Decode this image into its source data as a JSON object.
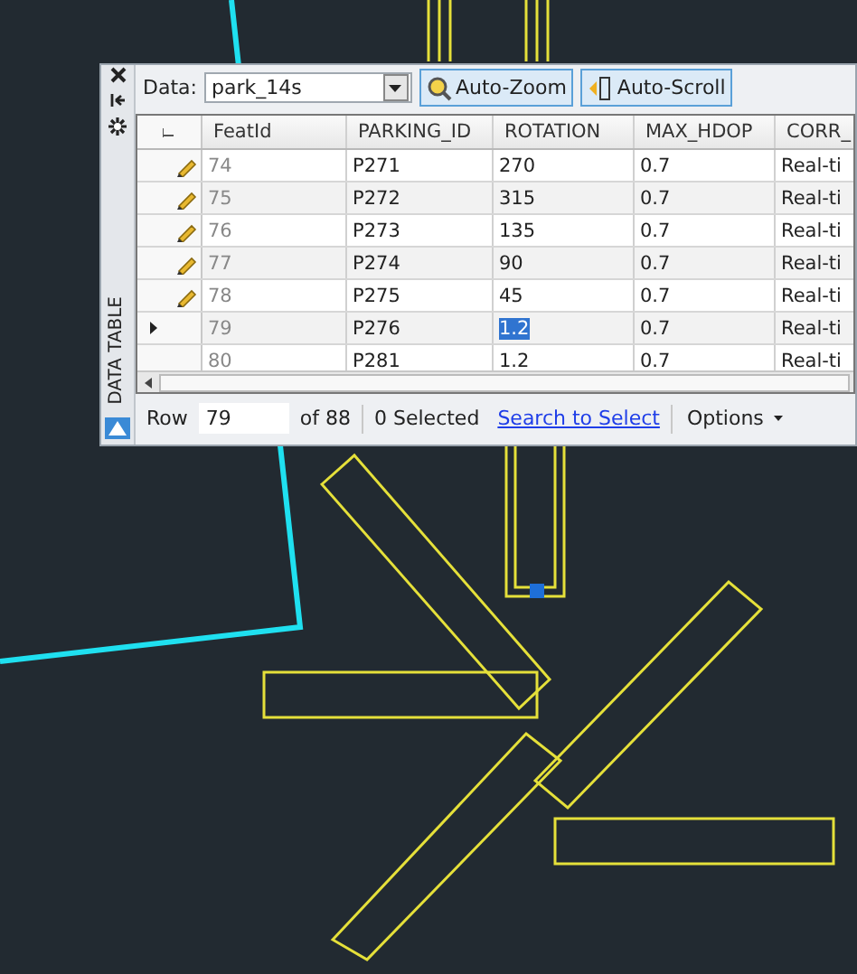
{
  "side_panel": {
    "title": "DATA TABLE"
  },
  "toolbar": {
    "data_label": "Data:",
    "dataset": "park_14s",
    "buttons": [
      {
        "label": "Auto-Zoom",
        "kind": "zoom",
        "selected": true
      },
      {
        "label": "Auto-Scroll",
        "kind": "scroll",
        "selected": true
      }
    ]
  },
  "table": {
    "columns": [
      "FeatId",
      "PARKING_ID",
      "ROTATION",
      "MAX_HDOP",
      "CORR_"
    ],
    "rows": [
      {
        "edited": true,
        "current": false,
        "cells": [
          {
            "text": "74",
            "selected": false
          },
          {
            "text": "P271",
            "selected": false
          },
          {
            "text": "270",
            "selected": false
          },
          {
            "text": "0.7",
            "selected": false
          },
          {
            "text": "Real-ti",
            "selected": false
          }
        ]
      },
      {
        "edited": true,
        "current": false,
        "cells": [
          {
            "text": "75",
            "selected": false
          },
          {
            "text": "P272",
            "selected": false
          },
          {
            "text": "315",
            "selected": false
          },
          {
            "text": "0.7",
            "selected": false
          },
          {
            "text": "Real-ti",
            "selected": false
          }
        ]
      },
      {
        "edited": true,
        "current": false,
        "cells": [
          {
            "text": "76",
            "selected": false
          },
          {
            "text": "P273",
            "selected": false
          },
          {
            "text": "135",
            "selected": false
          },
          {
            "text": "0.7",
            "selected": false
          },
          {
            "text": "Real-ti",
            "selected": false
          }
        ]
      },
      {
        "edited": true,
        "current": false,
        "cells": [
          {
            "text": "77",
            "selected": false
          },
          {
            "text": "P274",
            "selected": false
          },
          {
            "text": "90",
            "selected": false
          },
          {
            "text": "0.7",
            "selected": false
          },
          {
            "text": "Real-ti",
            "selected": false
          }
        ]
      },
      {
        "edited": true,
        "current": false,
        "cells": [
          {
            "text": "78",
            "selected": false
          },
          {
            "text": "P275",
            "selected": false
          },
          {
            "text": "45",
            "selected": false
          },
          {
            "text": "0.7",
            "selected": false
          },
          {
            "text": "Real-ti",
            "selected": false
          }
        ]
      },
      {
        "edited": false,
        "current": true,
        "cells": [
          {
            "text": "79",
            "selected": false
          },
          {
            "text": "P276",
            "selected": false
          },
          {
            "text": "1.2",
            "selected": true
          },
          {
            "text": "0.7",
            "selected": false
          },
          {
            "text": "Real-ti",
            "selected": false
          }
        ]
      },
      {
        "edited": false,
        "current": false,
        "cells": [
          {
            "text": "80",
            "selected": false
          },
          {
            "text": "P281",
            "selected": false
          },
          {
            "text": "1.2",
            "selected": false
          },
          {
            "text": "0.7",
            "selected": false
          },
          {
            "text": "Real-ti",
            "selected": false
          }
        ]
      }
    ]
  },
  "status_bar": {
    "row_label": "Row",
    "row_value": "79",
    "row_count": "of 88",
    "selected_count": "0 Selected",
    "link": "Search to Select",
    "options": "Options"
  }
}
